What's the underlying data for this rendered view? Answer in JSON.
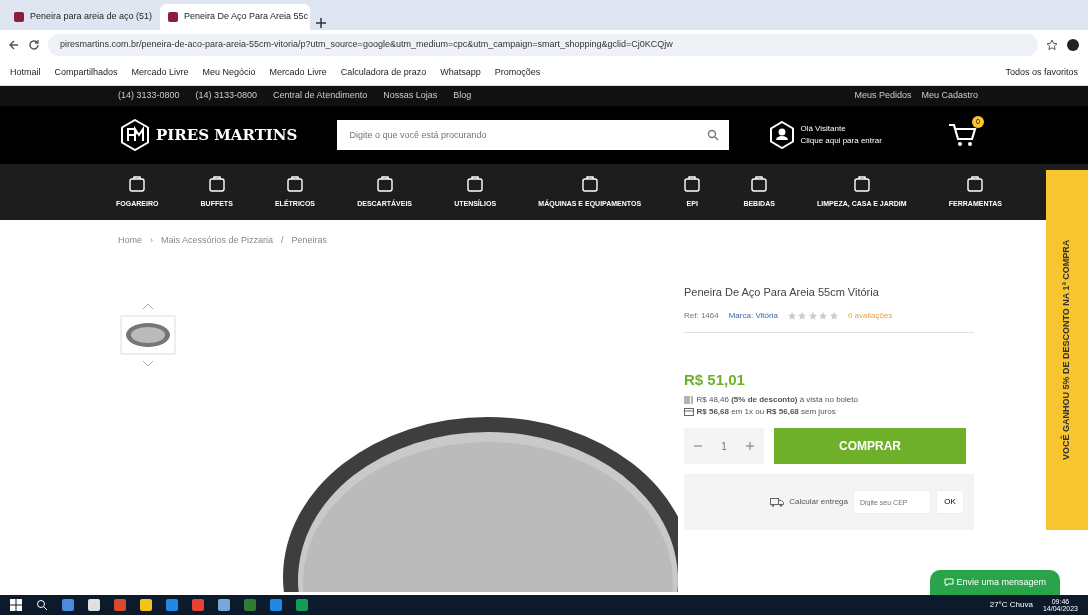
{
  "browser": {
    "tabs": [
      {
        "title": "Peneira para areia de aço (51)",
        "selected": false
      },
      {
        "title": "Peneira De Aço Para Areia 55c",
        "selected": true
      }
    ],
    "url": "piresmartins.com.br/peneira-de-aco-para-areia-55cm-vitoria/p?utm_source=google&utm_medium=cpc&utm_campaign=smart_shopping&gclid=Cj0KCQjw",
    "bookmarks": [
      "Hotmail",
      "Compartilhados",
      "Mercado Livre",
      "Meu Negócio",
      "Mercado Livre",
      "Calculadora de prazo",
      "Whatsapp",
      "Promoções"
    ],
    "other_bookmarks": "Todos os favoritos"
  },
  "site": {
    "top_links": [
      "(14) 3133-0800",
      "(14) 3133-0800",
      "Central de Atendimento",
      "Nossas Lojas",
      "Blog"
    ],
    "account_links": [
      "Meus Pedidos",
      "Meu Cadastro"
    ],
    "logo": "PIRES MARTINS",
    "search": {
      "placeholder": "Digite o que você está procurando"
    },
    "greeting": "Olá Visitante",
    "login": "Clique aqui para entrar",
    "cart_count": "0",
    "categories": [
      "FOGAREIRO",
      "BUFFETS",
      "ELÉTRICOS",
      "DESCARTÁVEIS",
      "UTENSÍLIOS",
      "MÁQUINAS E EQUIPAMENTOS",
      "EPI",
      "BEBIDAS",
      "LIMPEZA, CASA E JARDIM",
      "FERRAMENTAS"
    ]
  },
  "breadcrumb": {
    "items": [
      "Home",
      "Mais Acessórios de Pizzaria",
      "Peneiras"
    ],
    "separators": [
      "›",
      "/"
    ]
  },
  "product": {
    "title": "Peneira De Aço Para Areia 55cm Vitória",
    "ref": "Ref: 1464",
    "brand": "Marca: Vitória",
    "stars": 0,
    "reviews": "0 avaliações",
    "price": "R$ 51,01",
    "boleto": "R$ 48,46 **(5% de desconto)** à vista no boleto",
    "installments": "**R$ 56,68** em 1x ou **R$ 56,68** sem juros",
    "quantity": "1",
    "buy": "COMPRAR",
    "shipping_label": "Calcular entrega",
    "cep": {
      "placeholder": "Digite seu CEP"
    },
    "ok": "OK"
  },
  "promo_tab": "VOCÊ GANHOU 5% DE DESCONTO NA 1ª COMPRA",
  "chat": "Envie uma mensagem",
  "taskbar": {
    "weather": "27°C Chuva",
    "time": "09:46",
    "date": "14/04/2023"
  }
}
